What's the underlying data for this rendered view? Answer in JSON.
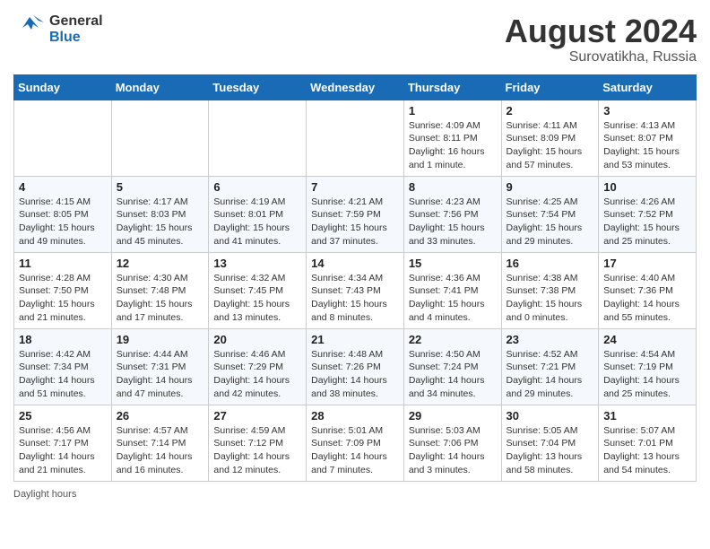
{
  "header": {
    "logo_line1": "General",
    "logo_line2": "Blue",
    "month_year": "August 2024",
    "location": "Surovatikha, Russia"
  },
  "days_of_week": [
    "Sunday",
    "Monday",
    "Tuesday",
    "Wednesday",
    "Thursday",
    "Friday",
    "Saturday"
  ],
  "weeks": [
    [
      {
        "day": "",
        "info": ""
      },
      {
        "day": "",
        "info": ""
      },
      {
        "day": "",
        "info": ""
      },
      {
        "day": "",
        "info": ""
      },
      {
        "day": "1",
        "info": "Sunrise: 4:09 AM\nSunset: 8:11 PM\nDaylight: 16 hours and 1 minute."
      },
      {
        "day": "2",
        "info": "Sunrise: 4:11 AM\nSunset: 8:09 PM\nDaylight: 15 hours and 57 minutes."
      },
      {
        "day": "3",
        "info": "Sunrise: 4:13 AM\nSunset: 8:07 PM\nDaylight: 15 hours and 53 minutes."
      }
    ],
    [
      {
        "day": "4",
        "info": "Sunrise: 4:15 AM\nSunset: 8:05 PM\nDaylight: 15 hours and 49 minutes."
      },
      {
        "day": "5",
        "info": "Sunrise: 4:17 AM\nSunset: 8:03 PM\nDaylight: 15 hours and 45 minutes."
      },
      {
        "day": "6",
        "info": "Sunrise: 4:19 AM\nSunset: 8:01 PM\nDaylight: 15 hours and 41 minutes."
      },
      {
        "day": "7",
        "info": "Sunrise: 4:21 AM\nSunset: 7:59 PM\nDaylight: 15 hours and 37 minutes."
      },
      {
        "day": "8",
        "info": "Sunrise: 4:23 AM\nSunset: 7:56 PM\nDaylight: 15 hours and 33 minutes."
      },
      {
        "day": "9",
        "info": "Sunrise: 4:25 AM\nSunset: 7:54 PM\nDaylight: 15 hours and 29 minutes."
      },
      {
        "day": "10",
        "info": "Sunrise: 4:26 AM\nSunset: 7:52 PM\nDaylight: 15 hours and 25 minutes."
      }
    ],
    [
      {
        "day": "11",
        "info": "Sunrise: 4:28 AM\nSunset: 7:50 PM\nDaylight: 15 hours and 21 minutes."
      },
      {
        "day": "12",
        "info": "Sunrise: 4:30 AM\nSunset: 7:48 PM\nDaylight: 15 hours and 17 minutes."
      },
      {
        "day": "13",
        "info": "Sunrise: 4:32 AM\nSunset: 7:45 PM\nDaylight: 15 hours and 13 minutes."
      },
      {
        "day": "14",
        "info": "Sunrise: 4:34 AM\nSunset: 7:43 PM\nDaylight: 15 hours and 8 minutes."
      },
      {
        "day": "15",
        "info": "Sunrise: 4:36 AM\nSunset: 7:41 PM\nDaylight: 15 hours and 4 minutes."
      },
      {
        "day": "16",
        "info": "Sunrise: 4:38 AM\nSunset: 7:38 PM\nDaylight: 15 hours and 0 minutes."
      },
      {
        "day": "17",
        "info": "Sunrise: 4:40 AM\nSunset: 7:36 PM\nDaylight: 14 hours and 55 minutes."
      }
    ],
    [
      {
        "day": "18",
        "info": "Sunrise: 4:42 AM\nSunset: 7:34 PM\nDaylight: 14 hours and 51 minutes."
      },
      {
        "day": "19",
        "info": "Sunrise: 4:44 AM\nSunset: 7:31 PM\nDaylight: 14 hours and 47 minutes."
      },
      {
        "day": "20",
        "info": "Sunrise: 4:46 AM\nSunset: 7:29 PM\nDaylight: 14 hours and 42 minutes."
      },
      {
        "day": "21",
        "info": "Sunrise: 4:48 AM\nSunset: 7:26 PM\nDaylight: 14 hours and 38 minutes."
      },
      {
        "day": "22",
        "info": "Sunrise: 4:50 AM\nSunset: 7:24 PM\nDaylight: 14 hours and 34 minutes."
      },
      {
        "day": "23",
        "info": "Sunrise: 4:52 AM\nSunset: 7:21 PM\nDaylight: 14 hours and 29 minutes."
      },
      {
        "day": "24",
        "info": "Sunrise: 4:54 AM\nSunset: 7:19 PM\nDaylight: 14 hours and 25 minutes."
      }
    ],
    [
      {
        "day": "25",
        "info": "Sunrise: 4:56 AM\nSunset: 7:17 PM\nDaylight: 14 hours and 21 minutes."
      },
      {
        "day": "26",
        "info": "Sunrise: 4:57 AM\nSunset: 7:14 PM\nDaylight: 14 hours and 16 minutes."
      },
      {
        "day": "27",
        "info": "Sunrise: 4:59 AM\nSunset: 7:12 PM\nDaylight: 14 hours and 12 minutes."
      },
      {
        "day": "28",
        "info": "Sunrise: 5:01 AM\nSunset: 7:09 PM\nDaylight: 14 hours and 7 minutes."
      },
      {
        "day": "29",
        "info": "Sunrise: 5:03 AM\nSunset: 7:06 PM\nDaylight: 14 hours and 3 minutes."
      },
      {
        "day": "30",
        "info": "Sunrise: 5:05 AM\nSunset: 7:04 PM\nDaylight: 13 hours and 58 minutes."
      },
      {
        "day": "31",
        "info": "Sunrise: 5:07 AM\nSunset: 7:01 PM\nDaylight: 13 hours and 54 minutes."
      }
    ]
  ],
  "footer": {
    "note": "Daylight hours"
  }
}
